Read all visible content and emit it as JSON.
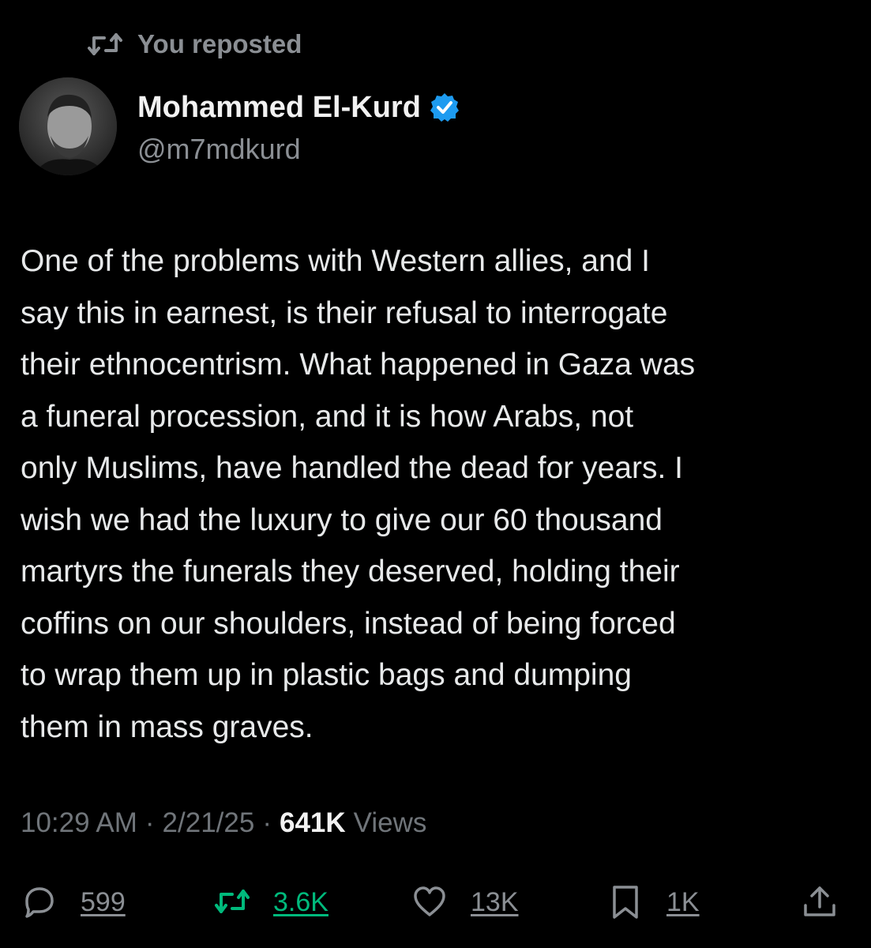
{
  "repost": {
    "label": "You reposted",
    "icon": "repost-icon"
  },
  "author": {
    "display_name": "Mohammed El-Kurd",
    "handle": "@m7mdkurd",
    "verified": true,
    "verified_color": "#1d9bf0",
    "avatar_icon": "avatar-photo"
  },
  "tweet": {
    "text": "One of the problems with Western allies, and I\nsay this in earnest, is their refusal to interrogate\ntheir ethnocentrism. What happened in Gaza was\na funeral procession, and it is how Arabs, not\nonly Muslims, have handled the dead for years. I\nwish we had the luxury to give our 60 thousand\nmartyrs the funerals they deserved, holding their\ncoffins on our shoulders, instead of being forced\nto wrap them up in plastic bags and dumping\nthem in mass graves."
  },
  "meta": {
    "time": "10:29 AM",
    "separator": "·",
    "date": "2/21/25",
    "views_count": "641K",
    "views_label": "Views"
  },
  "actions": {
    "reply": {
      "icon": "reply-icon",
      "count": "599"
    },
    "retweet": {
      "icon": "retweet-icon",
      "count": "3.6K",
      "active_color": "#00ba7c"
    },
    "like": {
      "icon": "heart-icon",
      "count": "13K"
    },
    "bookmark": {
      "icon": "bookmark-icon",
      "count": "1K"
    },
    "share": {
      "icon": "share-icon"
    }
  },
  "colors": {
    "background": "#000000",
    "text_primary": "#e7e9ea",
    "text_secondary": "#8b8f94",
    "accent_verified": "#1d9bf0",
    "retweet_green": "#00ba7c"
  }
}
